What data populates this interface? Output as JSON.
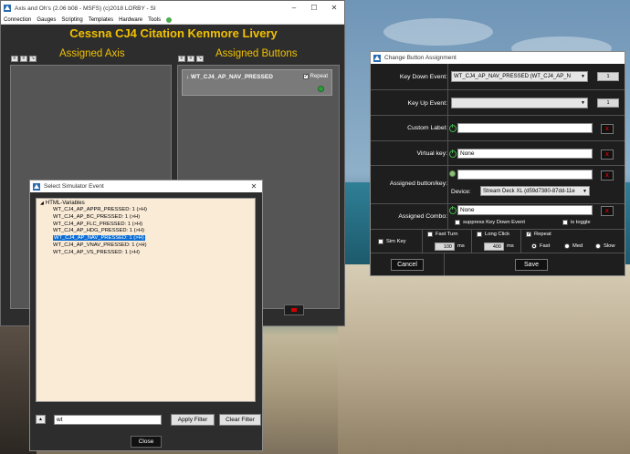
{
  "main_window": {
    "title": "Axis and Oh's (2.06 b08 - MSFS) (c)2018 LORBY - SI",
    "menu": [
      "Connection",
      "Gauges",
      "Scripting",
      "Templates",
      "Hardware",
      "Tools"
    ],
    "aircraft_title": "Cessna CJ4 Citation Kenmore Livery",
    "assigned_axis_title": "Assigned Axis",
    "assigned_buttons_title": "Assigned Buttons",
    "button_card": {
      "label": "↓ WT_CJ4_AP_NAV_PRESSED",
      "repeat_label": "Repeat",
      "repeat_checked": true
    },
    "delete_button_color": "#d40000"
  },
  "select_event_dialog": {
    "title": "Select Simulator Event",
    "root_label": "HTML-Variables",
    "items": [
      "WT_CJ4_AP_APPR_PRESSED: 1 (>H)",
      "WT_CJ4_AP_BC_PRESSED: 1 (>H)",
      "WT_CJ4_AP_FLC_PRESSED: 1 (>H)",
      "WT_CJ4_AP_HDG_PRESSED: 1 (>H)",
      "WT_CJ4_AP_NAV_PRESSED: 1 (>H)",
      "WT_CJ4_AP_VNAV_PRESSED: 1 (>H)",
      "WT_CJ4_AP_VS_PRESSED: 1 (>H)"
    ],
    "selected_index": 4,
    "filter_value": "wt",
    "apply_filter_label": "Apply Filter",
    "clear_filter_label": "Clear Filter",
    "close_label": "Close",
    "tree_background": "#faebd7"
  },
  "change_assignment_dialog": {
    "title": "Change Button Assignment",
    "key_down_label": "Key Down Event:",
    "key_down_value": "WT_CJ4_AP_NAV_PRESSED (WT_CJ4_AP_N",
    "key_down_count": "1",
    "key_up_label": "Key Up Event:",
    "key_up_value": "",
    "key_up_count": "1",
    "custom_label_label": "Custom Label:",
    "custom_label_value": "",
    "virtual_key_label": "Virtual key:",
    "virtual_key_value": "None",
    "assigned_button_label": "Assigned button/key:",
    "assigned_button_value": "",
    "device_label": "Device:",
    "device_value": "Stream Deck XL (d59d7380-87dd-11e",
    "assigned_combo_label": "Assigned Combo:",
    "assigned_combo_value": "None",
    "suppress_label": "suppress Key Down Event",
    "is_toggle_label": "is toggle",
    "fast_turn_label": "Fast Turn",
    "long_click_label": "Long Click",
    "repeat_label": "Repeat",
    "repeat_checked": true,
    "sim_key_label": "Sim Key",
    "fast_turn_ms": "100",
    "long_click_ms": "400",
    "ms_unit": "ms",
    "speed_options": [
      "Fast",
      "Med",
      "Slow"
    ],
    "speed_selected": "Fast",
    "cancel_label": "Cancel",
    "save_label": "Save"
  },
  "colors": {
    "title_accent": "#f2c100",
    "panel_bg": "#555555",
    "selection": "#0a6cd4",
    "status_green": "#2e9d3c"
  }
}
